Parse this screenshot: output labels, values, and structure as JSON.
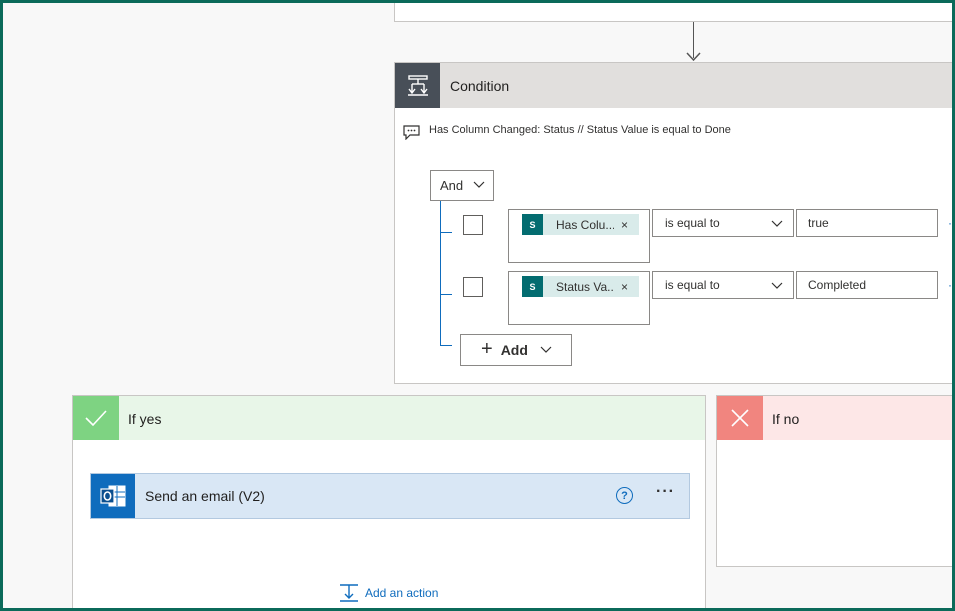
{
  "condition": {
    "title": "Condition",
    "icon": "condition-icon",
    "comment": "Has Column Changed: Status // Status Value is equal to Done",
    "group_operator": "And",
    "rows": [
      {
        "token_label": "Has Colu...",
        "token_icon": "sharepoint-icon",
        "token_icon_text": "S",
        "operator": "is equal to",
        "value": "true"
      },
      {
        "token_label": "Status Va...",
        "token_icon": "sharepoint-icon",
        "token_icon_text": "S",
        "operator": "is equal to",
        "value": "Completed"
      }
    ],
    "token_remove": "×",
    "add_label": "Add",
    "add_plus": "+"
  },
  "if_yes": {
    "title": "If yes",
    "color": "#7ed382",
    "action": {
      "title": "Send an email (V2)",
      "icon": "outlook-icon",
      "help": "?",
      "more": "···"
    },
    "add_action_label": "Add an action"
  },
  "if_no": {
    "title": "If no",
    "color": "#f1857f"
  },
  "row_more_glyph": "·"
}
